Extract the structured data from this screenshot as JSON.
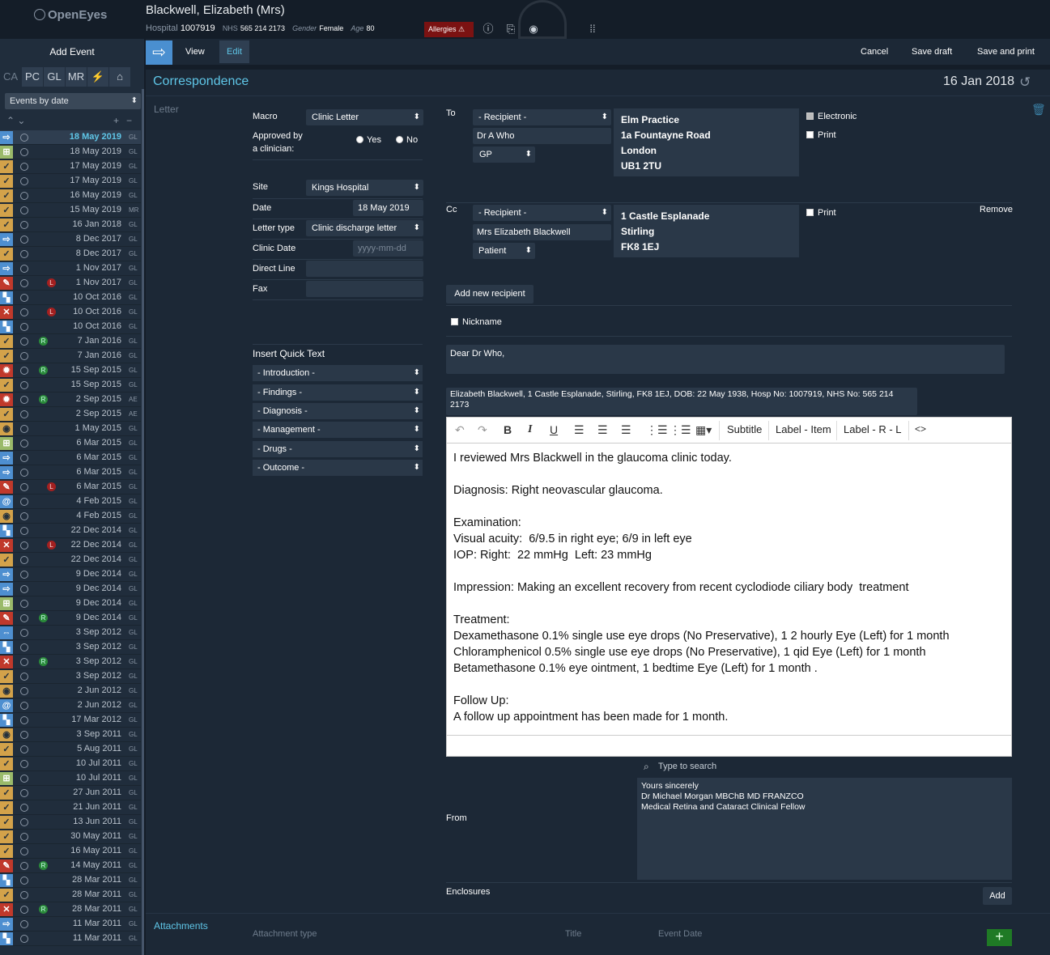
{
  "header": {
    "app_name": "OpenEyes",
    "patient_name": "Blackwell, Elizabeth (Mrs)",
    "hospital_label": "Hospital",
    "hospital_no": "1007919",
    "nhs_label": "NHS",
    "nhs_no": "565 214 2173",
    "gender_label": "Gender",
    "gender": "Female",
    "age_label": "Age",
    "age": "80",
    "allergies": "Allergies"
  },
  "sidebar": {
    "add_event": "Add Event",
    "filters": [
      "CA",
      "PC",
      "GL",
      "MR",
      "⚡",
      "⌂"
    ],
    "sort": "Events by date",
    "events": [
      {
        "date": "18 May 2019",
        "sp": "GL",
        "icon": "blue",
        "g": "⇨",
        "sel": true
      },
      {
        "date": "18 May 2019",
        "sp": "GL",
        "icon": "green",
        "g": "⊞"
      },
      {
        "date": "17 May 2019",
        "sp": "GL",
        "icon": "orange",
        "g": "✓"
      },
      {
        "date": "17 May 2019",
        "sp": "GL",
        "icon": "orange",
        "g": "✓"
      },
      {
        "date": "16 May 2019",
        "sp": "GL",
        "icon": "orange",
        "g": "✓"
      },
      {
        "date": "15 May 2019",
        "sp": "MR",
        "icon": "orange",
        "g": "✓"
      },
      {
        "date": "16 Jan 2018",
        "sp": "GL",
        "icon": "orange",
        "g": "✓"
      },
      {
        "date": "8 Dec 2017",
        "sp": "GL",
        "icon": "blue",
        "g": "⇨"
      },
      {
        "date": "8 Dec 2017",
        "sp": "GL",
        "icon": "orange",
        "g": "✓"
      },
      {
        "date": "1 Nov 2017",
        "sp": "GL",
        "icon": "blue",
        "g": "⇨"
      },
      {
        "date": "1 Nov 2017",
        "sp": "GL",
        "icon": "red",
        "g": "✎",
        "mk": "L"
      },
      {
        "date": "10 Oct 2016",
        "sp": "GL",
        "icon": "blue",
        "g": "▚"
      },
      {
        "date": "10 Oct 2016",
        "sp": "GL",
        "icon": "red",
        "g": "✕",
        "mk": "L"
      },
      {
        "date": "10 Oct 2016",
        "sp": "GL",
        "icon": "blue",
        "g": "▚"
      },
      {
        "date": "7 Jan 2016",
        "sp": "GL",
        "icon": "orange",
        "g": "✓",
        "mk": "R"
      },
      {
        "date": "7 Jan 2016",
        "sp": "GL",
        "icon": "orange",
        "g": "✓"
      },
      {
        "date": "15 Sep 2015",
        "sp": "GL",
        "icon": "red",
        "g": "✹",
        "mk": "R"
      },
      {
        "date": "15 Sep 2015",
        "sp": "GL",
        "icon": "orange",
        "g": "✓"
      },
      {
        "date": "2 Sep 2015",
        "sp": "AE",
        "icon": "red",
        "g": "✹",
        "mk": "R"
      },
      {
        "date": "2 Sep 2015",
        "sp": "AE",
        "icon": "orange",
        "g": "✓"
      },
      {
        "date": "1 May 2015",
        "sp": "GL",
        "icon": "orange",
        "g": "◉"
      },
      {
        "date": "6 Mar 2015",
        "sp": "GL",
        "icon": "green",
        "g": "⊞"
      },
      {
        "date": "6 Mar 2015",
        "sp": "GL",
        "icon": "blue",
        "g": "⇨"
      },
      {
        "date": "6 Mar 2015",
        "sp": "GL",
        "icon": "blue",
        "g": "⇨"
      },
      {
        "date": "6 Mar 2015",
        "sp": "GL",
        "icon": "red",
        "g": "✎",
        "mk": "L"
      },
      {
        "date": "4 Feb 2015",
        "sp": "GL",
        "icon": "blue",
        "g": "@"
      },
      {
        "date": "4 Feb 2015",
        "sp": "GL",
        "icon": "orange",
        "g": "◉"
      },
      {
        "date": "22 Dec 2014",
        "sp": "GL",
        "icon": "blue",
        "g": "▚"
      },
      {
        "date": "22 Dec 2014",
        "sp": "GL",
        "icon": "red",
        "g": "✕",
        "mk": "L"
      },
      {
        "date": "22 Dec 2014",
        "sp": "GL",
        "icon": "orange",
        "g": "✓"
      },
      {
        "date": "9 Dec 2014",
        "sp": "GL",
        "icon": "blue",
        "g": "⇨"
      },
      {
        "date": "9 Dec 2014",
        "sp": "GL",
        "icon": "blue",
        "g": "⇨"
      },
      {
        "date": "9 Dec 2014",
        "sp": "GL",
        "icon": "green",
        "g": "⊞"
      },
      {
        "date": "9 Dec 2014",
        "sp": "GL",
        "icon": "red",
        "g": "✎",
        "mk": "R"
      },
      {
        "date": "3 Sep 2012",
        "sp": "GL",
        "icon": "blue",
        "g": "⇔"
      },
      {
        "date": "3 Sep 2012",
        "sp": "GL",
        "icon": "blue",
        "g": "▚"
      },
      {
        "date": "3 Sep 2012",
        "sp": "GL",
        "icon": "red",
        "g": "✕",
        "mk": "R"
      },
      {
        "date": "3 Sep 2012",
        "sp": "GL",
        "icon": "orange",
        "g": "✓"
      },
      {
        "date": "2 Jun 2012",
        "sp": "GL",
        "icon": "orange",
        "g": "◉"
      },
      {
        "date": "2 Jun 2012",
        "sp": "GL",
        "icon": "blue",
        "g": "@"
      },
      {
        "date": "17 Mar 2012",
        "sp": "GL",
        "icon": "blue",
        "g": "▚"
      },
      {
        "date": "3 Sep 2011",
        "sp": "GL",
        "icon": "orange",
        "g": "◉"
      },
      {
        "date": "5 Aug 2011",
        "sp": "GL",
        "icon": "orange",
        "g": "✓"
      },
      {
        "date": "10 Jul 2011",
        "sp": "GL",
        "icon": "orange",
        "g": "✓"
      },
      {
        "date": "10 Jul 2011",
        "sp": "GL",
        "icon": "green",
        "g": "⊞"
      },
      {
        "date": "27 Jun 2011",
        "sp": "GL",
        "icon": "orange",
        "g": "✓"
      },
      {
        "date": "21 Jun 2011",
        "sp": "GL",
        "icon": "orange",
        "g": "✓"
      },
      {
        "date": "13 Jun 2011",
        "sp": "GL",
        "icon": "orange",
        "g": "✓"
      },
      {
        "date": "30 May 2011",
        "sp": "GL",
        "icon": "orange",
        "g": "✓"
      },
      {
        "date": "16 May 2011",
        "sp": "GL",
        "icon": "orange",
        "g": "✓"
      },
      {
        "date": "14 May 2011",
        "sp": "GL",
        "icon": "red",
        "g": "✎",
        "mk": "R"
      },
      {
        "date": "28 Mar 2011",
        "sp": "GL",
        "icon": "blue",
        "g": "▚"
      },
      {
        "date": "28 Mar 2011",
        "sp": "GL",
        "icon": "orange",
        "g": "✓"
      },
      {
        "date": "28 Mar 2011",
        "sp": "GL",
        "icon": "red",
        "g": "✕",
        "mk": "R"
      },
      {
        "date": "11 Mar 2011",
        "sp": "GL",
        "icon": "blue",
        "g": "⇨"
      },
      {
        "date": "11 Mar 2011",
        "sp": "GL",
        "icon": "blue",
        "g": "▚"
      }
    ]
  },
  "toolbar": {
    "view": "View",
    "edit": "Edit",
    "cancel": "Cancel",
    "save_draft": "Save draft",
    "save_print": "Save and print"
  },
  "event": {
    "title": "Correspondence",
    "date": "16 Jan 2018",
    "section": "Letter"
  },
  "form": {
    "macro_label": "Macro",
    "macro": "Clinic Letter",
    "approved_label1": "Approved by",
    "approved_label2": "a clinician:",
    "yes": "Yes",
    "no": "No",
    "site_label": "Site",
    "site": "Kings Hospital",
    "date_label": "Date",
    "date": "18 May 2019",
    "type_label": "Letter type",
    "type": "Clinic discharge letter",
    "clinic_label": "Clinic Date",
    "clinic_ph": "yyyy-mm-dd",
    "direct_label": "Direct Line",
    "fax_label": "Fax"
  },
  "to": {
    "label": "To",
    "recipient": "- Recipient -",
    "name": "Dr A Who",
    "role": "GP",
    "addr": [
      "Elm Practice",
      "1a Fountayne Road",
      "London",
      "UB1  2TU"
    ],
    "electronic": "Electronic",
    "print": "Print"
  },
  "cc": {
    "label": "Cc",
    "recipient": "- Recipient -",
    "name": "Mrs Elizabeth Blackwell",
    "role": "Patient",
    "addr": [
      "1 Castle Esplanade",
      "Stirling",
      "FK8 1EJ"
    ],
    "print": "Print",
    "remove": "Remove"
  },
  "add_recipient": "Add new recipient",
  "nickname": "Nickname",
  "quick_text": {
    "title": "Insert Quick Text",
    "items": [
      "- Introduction -",
      "- Findings -",
      "- Diagnosis -",
      "- Management -",
      "- Drugs -",
      "- Outcome -"
    ]
  },
  "salutation": "Dear Dr Who,",
  "re_line": "Elizabeth Blackwell, 1 Castle Esplanade, Stirling, FK8 1EJ, DOB: 22 May 1938, Hosp No: 1007919, NHS No: 565 214 2173",
  "editor_tools": {
    "subtitle": "Subtitle",
    "label_item": "Label - Item",
    "label_rl": "Label - R - L"
  },
  "letter_body": [
    "I reviewed Mrs Blackwell in the glaucoma clinic today.",
    "",
    "Diagnosis: Right neovascular glaucoma.",
    "",
    "Examination:",
    "Visual acuity:  6/9.5 in right eye; 6/9 in left eye",
    "IOP: Right:  22 mmHg  Left: 23 mmHg",
    "",
    "Impression: Making an excellent recovery from recent cyclodiode ciliary body  treatment",
    "",
    "Treatment:",
    "Dexamethasone 0.1% single use eye drops (No Preservative), 1 2 hourly Eye (Left) for 1 month",
    "Chloramphenicol 0.5% single use eye drops (No Preservative), 1 qid Eye (Left) for 1 month",
    "Betamethasone 0.1% eye ointment, 1 bedtime Eye (Left) for 1 month .",
    "",
    "Follow Up:",
    "A follow up appointment has been made for 1 month."
  ],
  "from": {
    "label": "From",
    "search_ph": "Type to search",
    "lines": [
      "Yours sincerely",
      "Dr Michael Morgan MBChB MD FRANZCO",
      "Medical Retina and Cataract Clinical Fellow"
    ]
  },
  "enclosures": {
    "label": "Enclosures",
    "add": "Add"
  },
  "attachments": {
    "label": "Attachments",
    "type": "Attachment type",
    "title": "Title",
    "date": "Event Date"
  }
}
